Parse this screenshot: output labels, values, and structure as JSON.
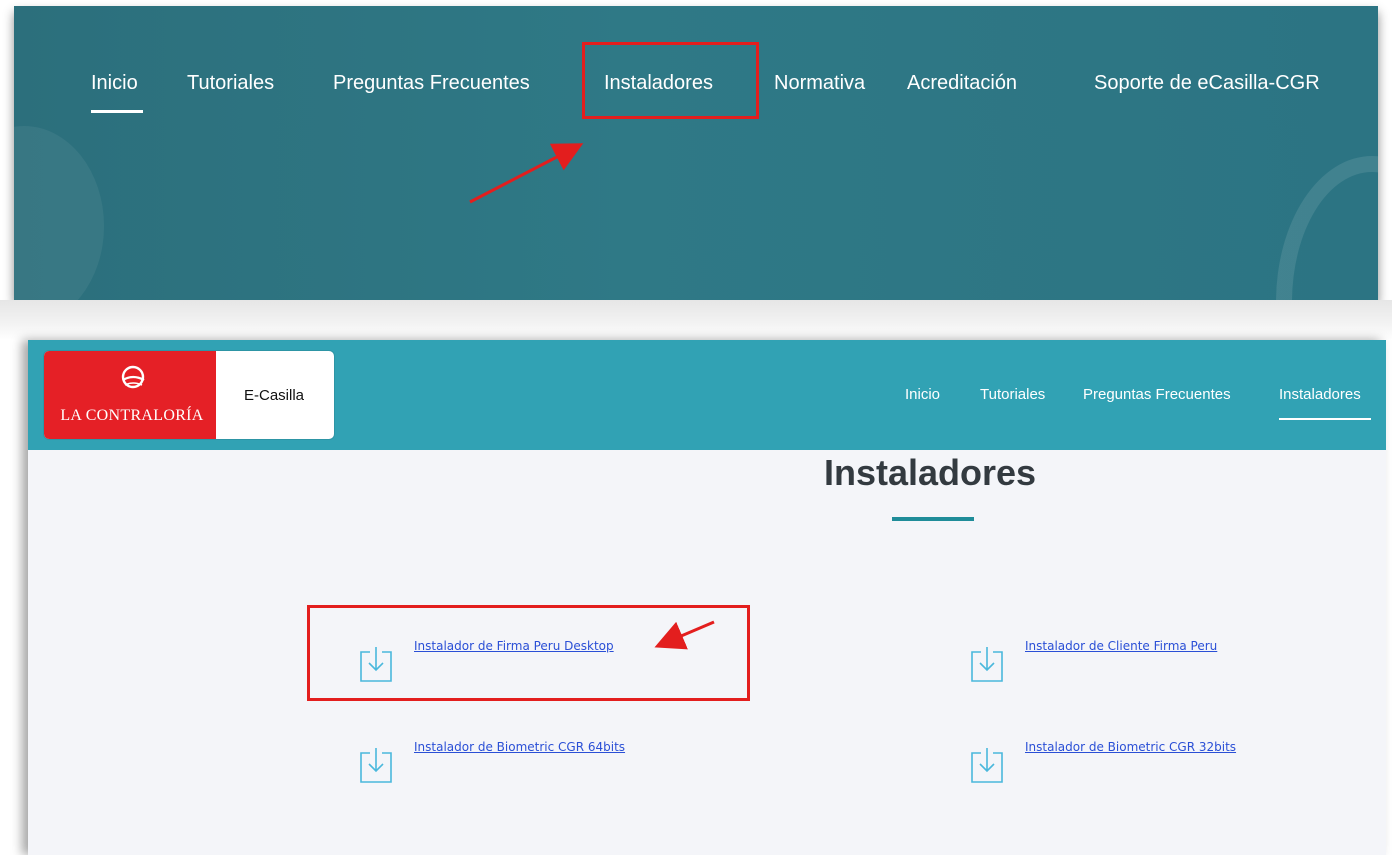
{
  "top_panel": {
    "nav_items": [
      {
        "label": "Inicio"
      },
      {
        "label": "Tutoriales"
      },
      {
        "label": "Preguntas Frecuentes"
      },
      {
        "label": "Instaladores"
      },
      {
        "label": "Normativa"
      },
      {
        "label": "Acreditación"
      },
      {
        "label": "Soporte de eCasilla-CGR"
      }
    ]
  },
  "header": {
    "logo_text": "LA CONTRALORÍA",
    "app_name": "E-Casilla",
    "nav_items": [
      {
        "label": "Inicio"
      },
      {
        "label": "Tutoriales"
      },
      {
        "label": "Preguntas Frecuentes"
      },
      {
        "label": "Instaladores"
      }
    ],
    "active_item": "Instaladores"
  },
  "main": {
    "title": "Instaladores",
    "downloads": [
      {
        "label": "Instalador de Firma Peru Desktop",
        "icon": "download-icon"
      },
      {
        "label": "Instalador de Cliente Firma Peru",
        "icon": "download-icon"
      },
      {
        "label": "Instalador de Biometric CGR 64bits",
        "icon": "download-icon"
      },
      {
        "label": "Instalador de Biometric CGR 32bits",
        "icon": "download-icon"
      }
    ]
  },
  "colors": {
    "top_banner": "#2f7986",
    "header_bar": "#31a2b4",
    "brand_red": "#e52026",
    "annotation_red": "#e31e1e",
    "link_blue": "#2a4fd6",
    "icon_blue": "#4ab8dc"
  }
}
